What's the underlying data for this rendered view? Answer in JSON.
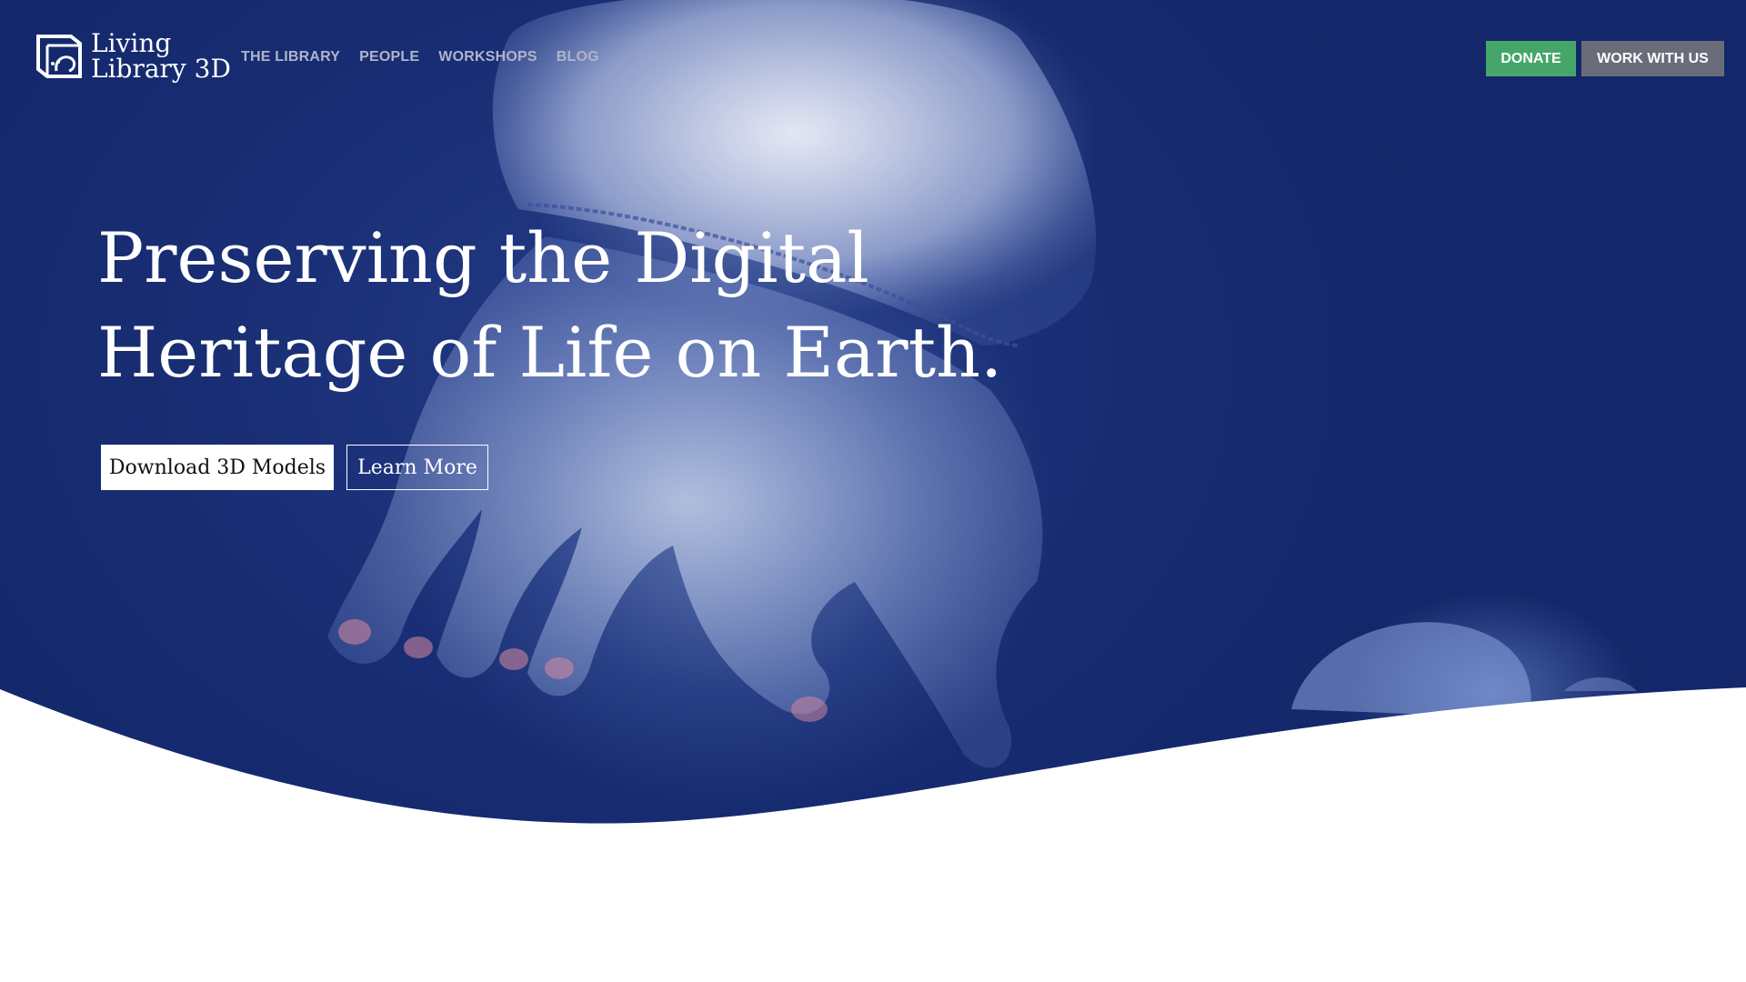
{
  "header": {
    "logo": {
      "line1": "Living",
      "line2": "Library 3D",
      "icon": "living-library-logo-icon"
    },
    "nav": [
      {
        "label": "THE LIBRARY"
      },
      {
        "label": "PEOPLE"
      },
      {
        "label": "WORKSHOPS"
      },
      {
        "label": "BLOG"
      }
    ],
    "donate_label": "DONATE",
    "work_with_us_label": "WORK WITH US"
  },
  "hero": {
    "headline_line1": "Preserving the Digital",
    "headline_line2": "Heritage of Life on Earth.",
    "primary_button": "Download 3D Models",
    "secondary_button": "Learn More",
    "background": "jellyfish-photo"
  },
  "colors": {
    "hero_blue": "#182d73",
    "donate_green": "#46a66a",
    "work_gray": "#6a6d79",
    "nav_text": "#aeb5c9"
  }
}
